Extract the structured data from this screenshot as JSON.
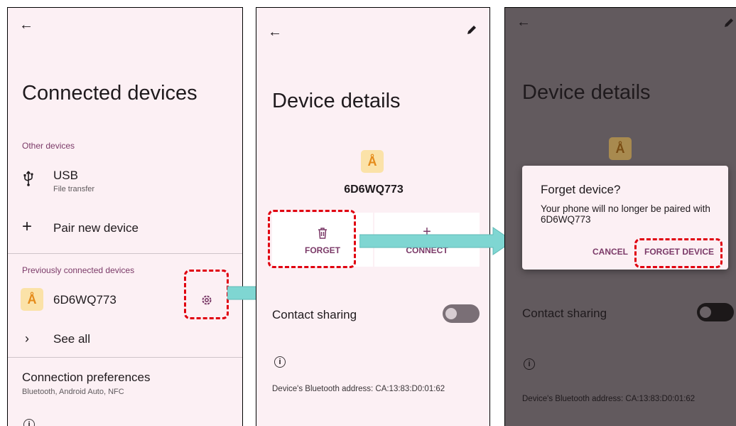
{
  "screen1": {
    "title": "Connected devices",
    "other_devices_header": "Other devices",
    "usb": {
      "icon": "usb-icon",
      "title": "USB",
      "subtitle": "File transfer"
    },
    "pair": {
      "icon": "plus-icon",
      "label": "Pair new device"
    },
    "previous_header": "Previously connected devices",
    "device": {
      "icon": "bluetooth-icon",
      "name": "6D6WQ773",
      "settings_icon": "gear-icon"
    },
    "see_all": {
      "icon": "chevron-right-icon",
      "label": "See all"
    },
    "connection_prefs": {
      "title": "Connection preferences",
      "subtitle": "Bluetooth, Android Auto, NFC"
    }
  },
  "screen2": {
    "title": "Device details",
    "device_name": "6D6WQ773",
    "forget_label": "FORGET",
    "connect_label": "CONNECT",
    "contact_sharing": "Contact sharing",
    "contact_sharing_on": false,
    "address": "Device's Bluetooth address: CA:13:83:D0:01:62"
  },
  "screen3": {
    "title": "Device details",
    "contact_sharing": "Contact sharing",
    "address": "Device's Bluetooth address: CA:13:83:D0:01:62",
    "dialog": {
      "title": "Forget device?",
      "message": "Your phone will no longer be paired with 6D6WQ773",
      "cancel_label": "CANCEL",
      "confirm_label": "FORGET DEVICE"
    }
  },
  "colors": {
    "accent": "#7b3a68",
    "highlight": "#e0000f",
    "arrow": "#7fd6d2",
    "background": "#fcf0f4",
    "scrim": "#625a5e"
  }
}
